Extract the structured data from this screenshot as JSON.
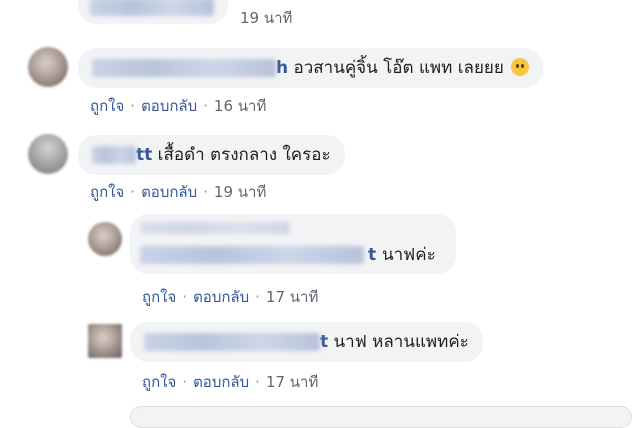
{
  "comments": [
    {
      "text": "",
      "actions": {
        "like": "",
        "reply": ""
      },
      "time": "19 นาที"
    },
    {
      "name_tail": "h",
      "text": "อวสานคู่จิ้น โอ๊ต แพท เลยยย",
      "emoji": "sad-face-emoji",
      "actions": {
        "like": "ถูกใจ",
        "reply": "ตอบกลับ"
      },
      "time": "16 นาที"
    },
    {
      "name_tail": "tt",
      "text": "เสื้อดำ ตรงกลาง ใครอะ",
      "actions": {
        "like": "ถูกใจ",
        "reply": "ตอบกลับ"
      },
      "time": "19 นาที"
    },
    {
      "name_tail": "t",
      "text": "นาฟค่ะ",
      "actions": {
        "like": "ถูกใจ",
        "reply": "ตอบกลับ"
      },
      "time": "17 นาที"
    },
    {
      "name_tail": "t",
      "text": "นาฟ หลานแพทค่ะ",
      "actions": {
        "like": "ถูกใจ",
        "reply": "ตอบกลับ"
      },
      "time": "17 นาที"
    }
  ],
  "colors": {
    "bubble": "#f2f3f5",
    "link": "#365899",
    "name": "#385898",
    "muted": "#606770"
  }
}
